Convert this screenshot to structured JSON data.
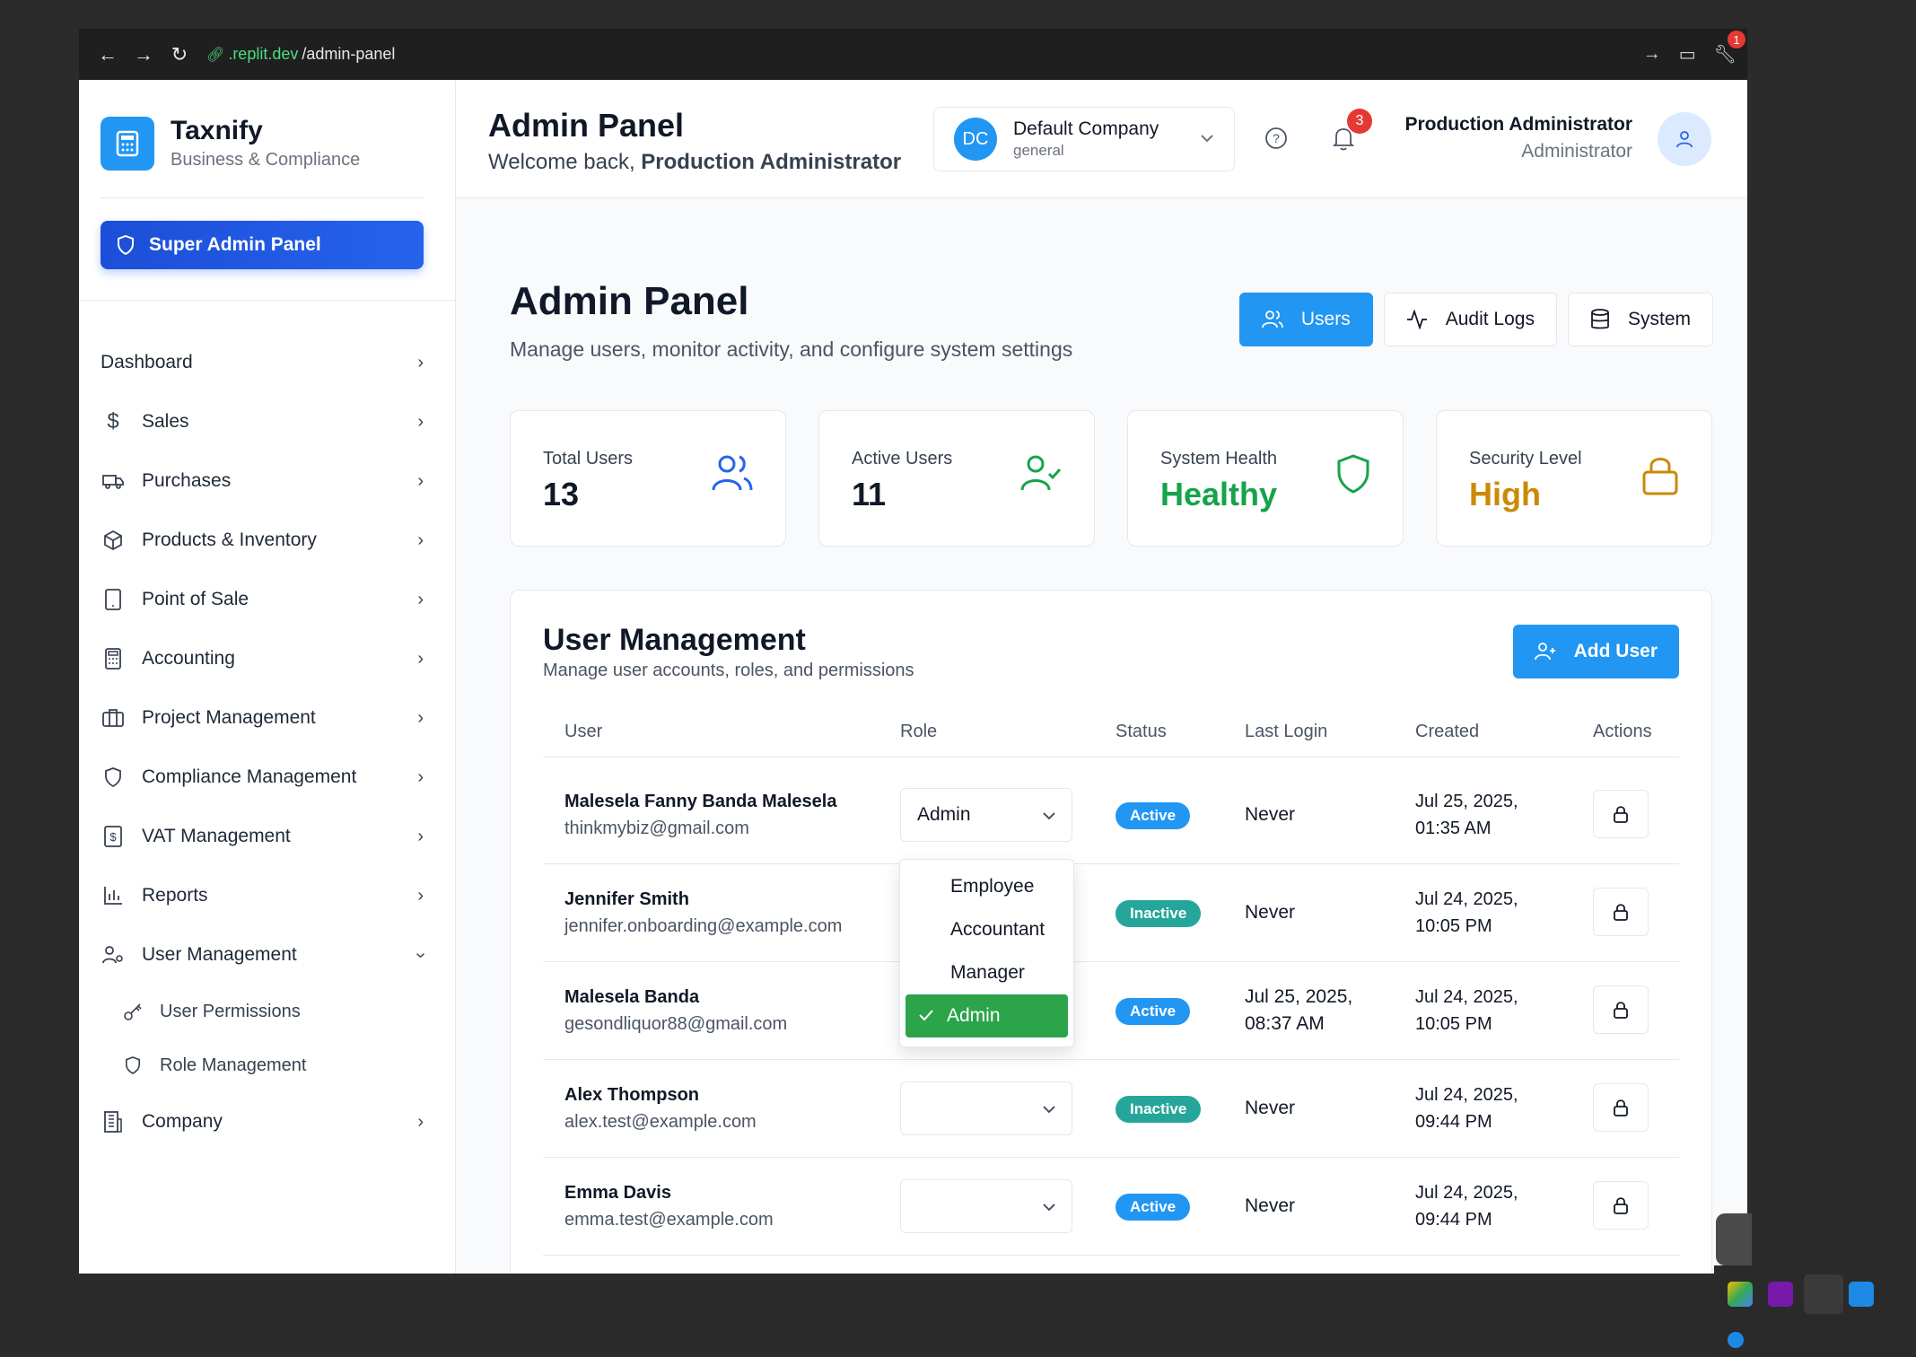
{
  "browser": {
    "url_domain": ".replit.dev",
    "url_path": "/admin-panel",
    "ext_badge": "1"
  },
  "brand": {
    "name": "Taxnify",
    "subtitle": "Business & Compliance"
  },
  "sidebar": {
    "super_admin": "Super Admin Panel",
    "items": [
      {
        "label": "Dashboard",
        "icon": "none"
      },
      {
        "label": "Sales",
        "icon": "dollar-icon"
      },
      {
        "label": "Purchases",
        "icon": "truck-icon"
      },
      {
        "label": "Products & Inventory",
        "icon": "box-icon"
      },
      {
        "label": "Point of Sale",
        "icon": "tablet-icon"
      },
      {
        "label": "Accounting",
        "icon": "calculator-icon"
      },
      {
        "label": "Project Management",
        "icon": "briefcase-icon"
      },
      {
        "label": "Compliance Management",
        "icon": "shield-icon"
      },
      {
        "label": "VAT Management",
        "icon": "receipt-icon"
      },
      {
        "label": "Reports",
        "icon": "bar-chart-icon"
      },
      {
        "label": "User Management",
        "icon": "user-cog-icon"
      }
    ],
    "sub_items": [
      {
        "label": "User Permissions",
        "icon": "key-icon"
      },
      {
        "label": "Role Management",
        "icon": "shield-icon"
      }
    ],
    "company": "Company"
  },
  "header": {
    "title": "Admin Panel",
    "welcome_prefix": "Welcome back, ",
    "welcome_name": "Production Administrator",
    "company_initials": "DC",
    "company_name": "Default Company",
    "company_type": "general",
    "notif_count": "3",
    "user_name": "Production Administrator",
    "user_role": "Administrator"
  },
  "main": {
    "title": "Admin Panel",
    "subtitle": "Manage users, monitor activity, and configure system settings",
    "tabs": [
      "Users",
      "Audit Logs",
      "System"
    ]
  },
  "stats": [
    {
      "label": "Total Users",
      "value": "13",
      "color": "#2563eb"
    },
    {
      "label": "Active Users",
      "value": "11",
      "color": "#16a34a"
    },
    {
      "label": "System Health",
      "value": "Healthy",
      "color": "#16a34a"
    },
    {
      "label": "Security Level",
      "value": "High",
      "color": "#ca8a04"
    }
  ],
  "users_card": {
    "title": "User Management",
    "subtitle": "Manage user accounts, roles, and permissions",
    "add_label": "Add User",
    "columns": [
      "User",
      "Role",
      "Status",
      "Last Login",
      "Created",
      "Actions"
    ],
    "rows": [
      {
        "name": "Malesela Fanny Banda Malesela",
        "email": "thinkmybiz@gmail.com",
        "role": "Admin",
        "status": "Active",
        "login1": "Never",
        "login2": "",
        "created1": "Jul 25, 2025,",
        "created2": "01:35 AM"
      },
      {
        "name": "Jennifer Smith",
        "email": "jennifer.onboarding@example.com",
        "role": "",
        "status": "Inactive",
        "login1": "Never",
        "login2": "",
        "created1": "Jul 24, 2025,",
        "created2": "10:05 PM"
      },
      {
        "name": "Malesela Banda",
        "email": "gesondliquor88@gmail.com",
        "role": "",
        "status": "Active",
        "login1": "Jul 25, 2025,",
        "login2": "08:37 AM",
        "created1": "Jul 24, 2025,",
        "created2": "10:05 PM"
      },
      {
        "name": "Alex Thompson",
        "email": "alex.test@example.com",
        "role": "",
        "status": "Inactive",
        "login1": "Never",
        "login2": "",
        "created1": "Jul 24, 2025,",
        "created2": "09:44 PM"
      },
      {
        "name": "Emma Davis",
        "email": "emma.test@example.com",
        "role": "",
        "status": "Active",
        "login1": "Never",
        "login2": "",
        "created1": "Jul 24, 2025,",
        "created2": "09:44 PM"
      }
    ]
  },
  "role_dropdown": {
    "options": [
      "Employee",
      "Accountant",
      "Manager",
      "Admin"
    ],
    "selected": "Admin"
  }
}
